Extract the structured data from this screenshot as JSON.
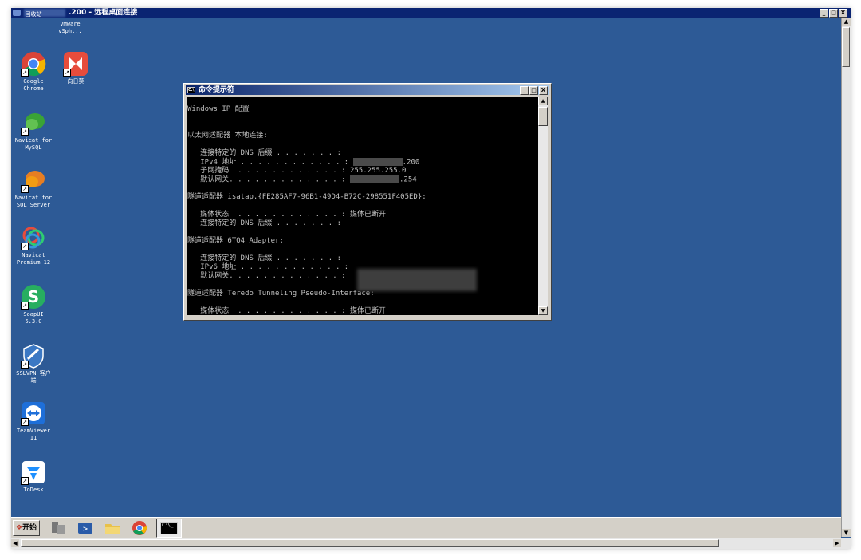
{
  "remote_window": {
    "title": ".200 - 远程桌面连接",
    "controls": [
      "_",
      "□",
      "X"
    ]
  },
  "desktop_icons": [
    {
      "name": "recycle-bin",
      "label": "回收站"
    },
    {
      "name": "vmware-vsphere",
      "label": "VMware\nvSph..."
    },
    {
      "name": "google-chrome",
      "label": "Google\nChrome"
    },
    {
      "name": "xiangrikui",
      "label": "向日葵"
    },
    {
      "name": "navicat-mysql",
      "label": "Navicat for\nMySQL"
    },
    {
      "name": "navicat-sqlserver",
      "label": "Navicat for\nSQL Server"
    },
    {
      "name": "navicat-premium",
      "label": "Navicat\nPremium 12"
    },
    {
      "name": "soapui",
      "label": "SoapUI\n5.3.0"
    },
    {
      "name": "sslvpn",
      "label": "SSLVPN 客户\n端"
    },
    {
      "name": "teamviewer",
      "label": "TeamViewer\n11"
    },
    {
      "name": "todesk",
      "label": "ToDesk"
    }
  ],
  "cmd_window": {
    "title": "命令提示符",
    "lines": [
      "",
      "Windows IP 配置",
      "",
      "",
      "以太网适配器 本地连接:",
      "",
      "   连接特定的 DNS 后缀 . . . . . . . :",
      "   IPv4 地址 . . . . . . . . . . . . :",
      "   子网掩码  . . . . . . . . . . . . : 255.255.255.0",
      "   默认网关. . . . . . . . . . . . . :",
      "",
      "隧道适配器 isatap.{FE285AF7-96B1-49D4-B72C-298551F405ED}:",
      "",
      "   媒体状态  . . . . . . . . . . . . : 媒体已断开",
      "   连接特定的 DNS 后缀 . . . . . . . :",
      "",
      "隧道适配器 6TO4 Adapter:",
      "",
      "   连接特定的 DNS 后缀 . . . . . . . :",
      "   IPv6 地址 . . . . . . . . . . . . :",
      "   默认网关. . . . . . . . . . . . . :",
      "",
      "隧道适配器 Teredo Tunneling Pseudo-Interface:",
      "",
      "   媒体状态  . . . . . . . . . . . . : 媒体已断开"
    ],
    "ipv4_suffix": ".200",
    "gateway_suffix": ".254"
  },
  "taskbar": {
    "start_label": "开始",
    "items": [
      "server-manager-icon",
      "powershell-icon",
      "explorer-icon",
      "chrome-icon",
      "cmd-icon"
    ]
  },
  "colors": {
    "desktop": "#2d5a96",
    "titlebar": "#0a2472",
    "console_bg": "#000000",
    "console_text": "#c0c0c0"
  }
}
